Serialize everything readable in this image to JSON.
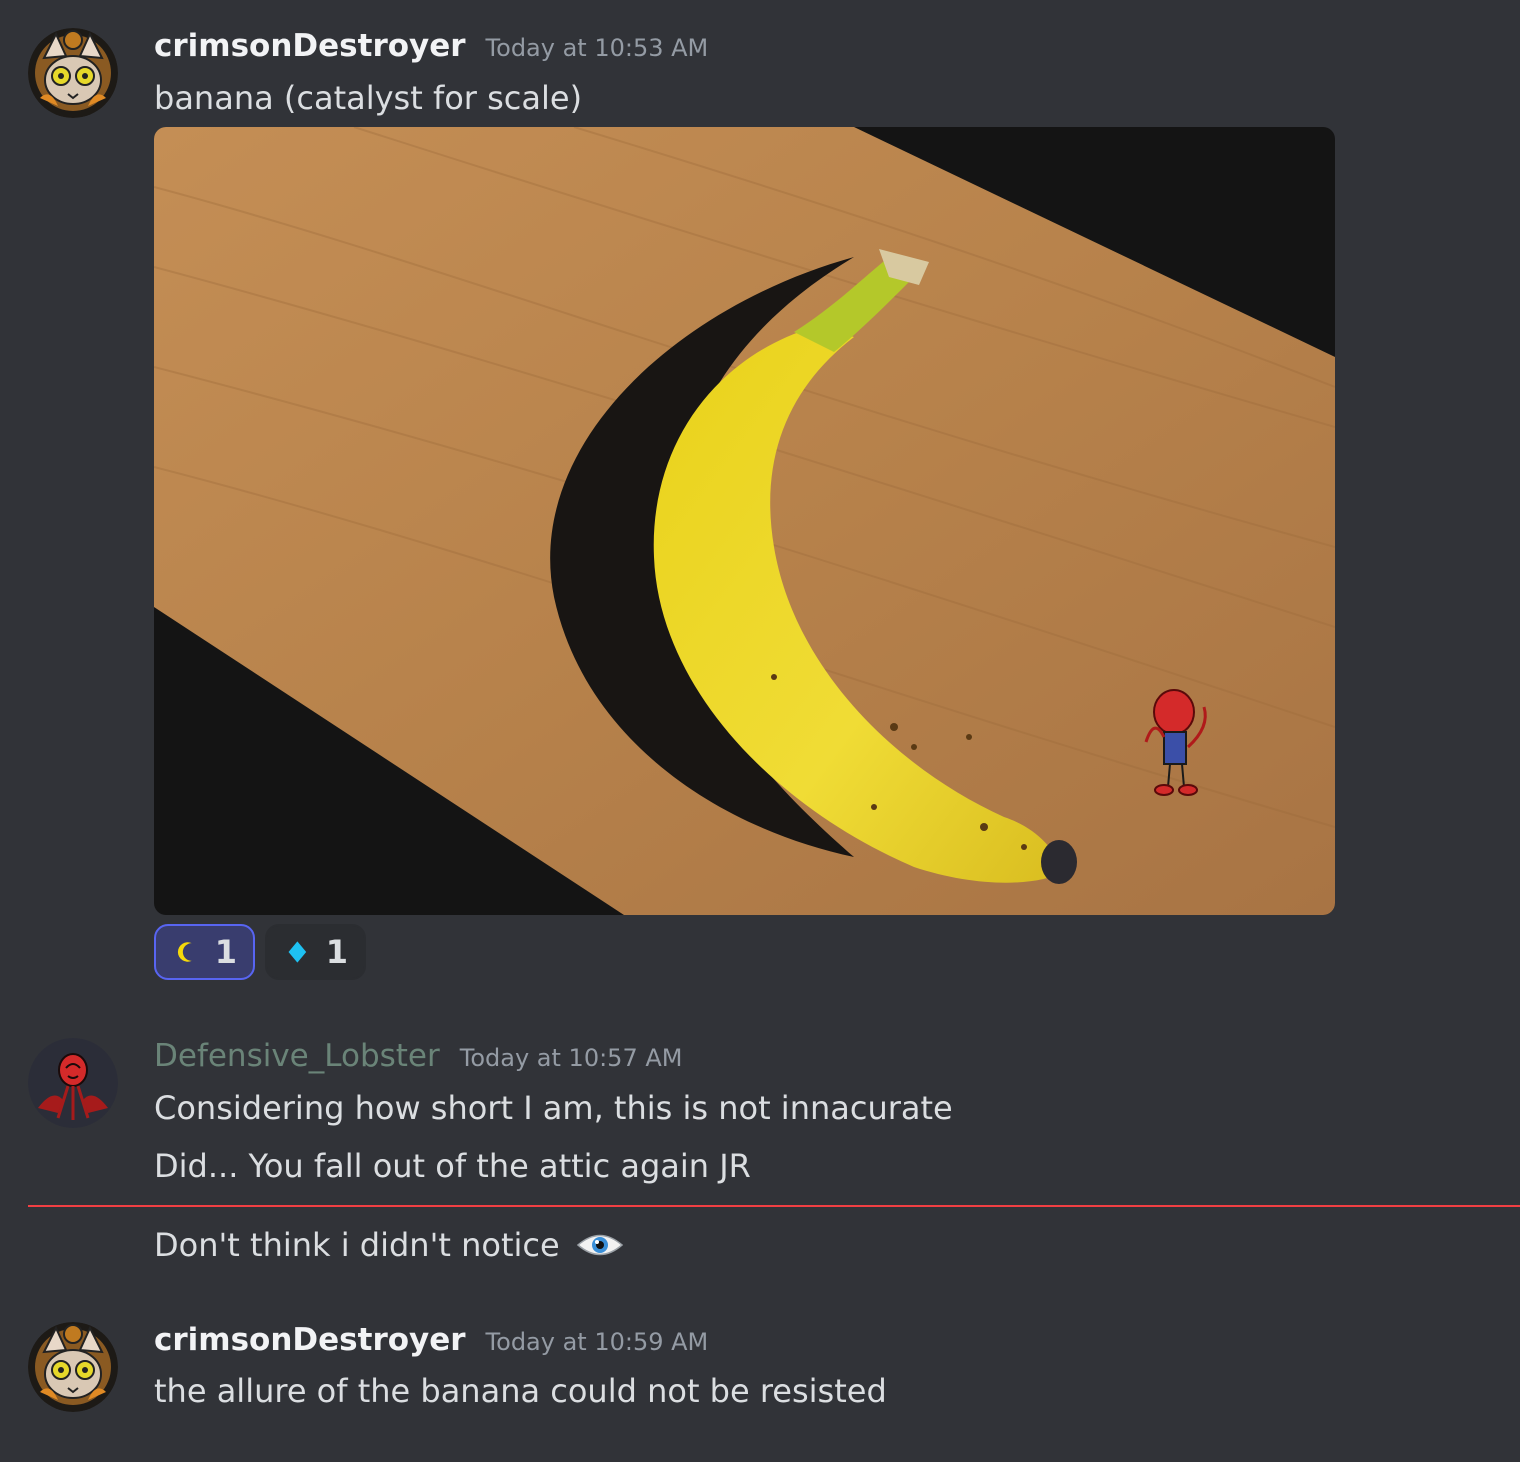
{
  "messages": [
    {
      "username": "crimsonDestroyer",
      "username_color": "#f2f3f5",
      "timestamp": "Today at 10:53 AM",
      "lines": [
        "banana (catalyst for scale)"
      ],
      "has_image_attachment": true,
      "reactions": [
        {
          "emoji_icon": "crescent-moon-icon",
          "count": "1",
          "reacted_by_me": true
        },
        {
          "emoji_icon": "blue-diamond-icon",
          "count": "1",
          "reacted_by_me": false
        }
      ]
    },
    {
      "username": "Defensive_Lobster",
      "username_color": "#6a8478",
      "timestamp": "Today at 10:57 AM",
      "lines": [
        "Considering how short I am, this is not innacurate",
        "Did... You fall out of the attic again JR",
        "Don't think i didn't notice"
      ],
      "last_line_emoji_icon": "eye-icon",
      "new_messages_divider_after_line": 2
    },
    {
      "username": "crimsonDestroyer",
      "username_color": "#f2f3f5",
      "timestamp": "Today at 10:59 AM",
      "lines": [
        "the allure of the banana could not be resisted"
      ]
    }
  ]
}
